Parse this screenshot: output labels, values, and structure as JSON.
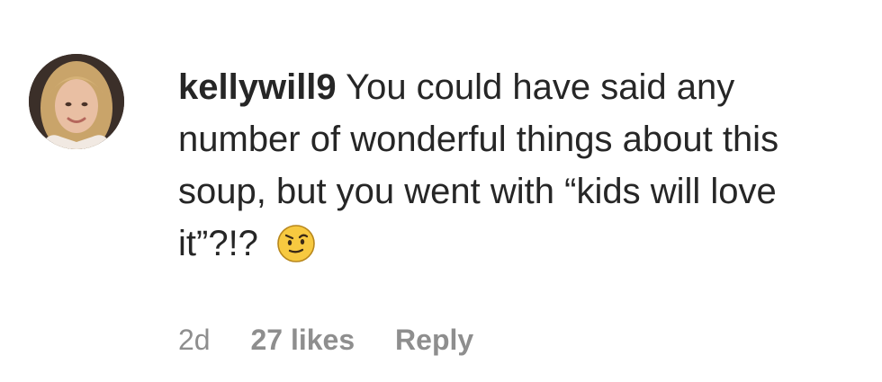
{
  "comment": {
    "username": "kellywill9",
    "text": "You could have said any number of wonderful things about this soup, but you went with “kids will love it”?!?",
    "emoji_icon": "raised-eyebrow-emoji-icon",
    "time": "2d",
    "likes": "27 likes",
    "reply_label": "Reply"
  },
  "colors": {
    "text": "#262626",
    "meta": "#8e8e8e",
    "emoji_face": "#f7c940"
  }
}
